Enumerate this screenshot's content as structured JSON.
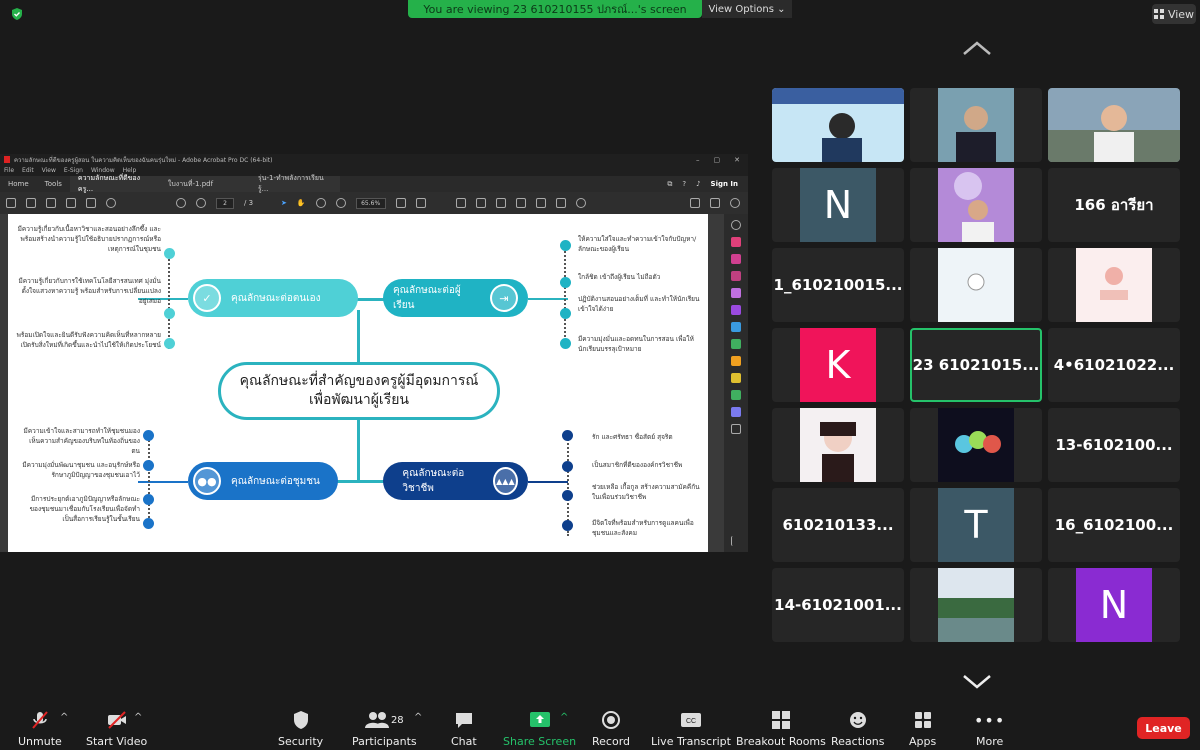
{
  "banner": {
    "text": "You are viewing 23 610210155 ปภรณ์...'s screen",
    "view_options": "View Options"
  },
  "view_button": "View",
  "acrobat": {
    "title": "ความลักษณะที่ดีของครูผู้สอน ในความคิดเห็นของฉันคนรุ่นใหม่ - Adobe Acrobat Pro DC (64-bit)",
    "menu": [
      "File",
      "Edit",
      "View",
      "E-Sign",
      "Window",
      "Help"
    ],
    "tabs": {
      "home": "Home",
      "tools": "Tools",
      "doc1": "ความลักษณะที่ดีของครู...",
      "doc2": "ใบงานที่-1.pdf",
      "doc3": "รุ่น-1-ทำพลังการเรียนรู้..."
    },
    "signin": "Sign In",
    "page_num": "2",
    "page_total": "/ 3",
    "zoom": "65.6%"
  },
  "mindmap": {
    "center_line1": "คุณลักษณะที่สำคัญของครูผู้มีอุดมการณ์",
    "center_line2": "เพื่อพัฒนาผู้เรียน",
    "tl_label": "คุณลักษณะต่อตนเอง",
    "tr_label": "คุณลักษณะต่อผู้เรียน",
    "bl_label": "คุณลักษณะต่อชุมชน",
    "br_label": "คุณลักษณะต่อวิชาชีพ",
    "tl_items": [
      "มีความรู้เกี่ยวกับเนื้อหาวิชาและสอนอย่างลึกซึ้ง และพร้อมสร้างนำความรู้ไปใช้อธิบายปรากฏการณ์หรือเหตุการณ์ในชุมชน",
      "มีความรู้เกี่ยวกับการใช้เทคโนโลยีสารสนเทศ มุ่งมั่นตั้งใจแสวงหาความรู้ พร้อมสำหรับการเปลี่ยนแปลงอยู่เสมอ",
      "พร้อมเปิดใจและยินดีรับฟังความคิดเห็นที่หลากหลาย เปิดรับสิ่งใหม่ที่เกิดขึ้นและนำไปใช้ให้เกิดประโยชน์"
    ],
    "tr_items": [
      "ให้ความใส่ใจและทำความเข้าใจกับปัญหา/ลักษณะของผู้เรียน",
      "ใกล้ชิด เข้าถึงผู้เรียน ไม่ถือตัว",
      "ปฏิบัติงานสอนอย่างเต็มที่ และทำให้นักเรียนเข้าใจได้ง่าย",
      "มีความมุ่งมั่นและอดทนในการสอน เพื่อให้นักเรียนบรรลุเป้าหมาย"
    ],
    "bl_items": [
      "มีความเข้าใจและสามารถทำให้ชุมชนมองเห็นความสำคัญของบริบทในท้องถิ่นของตน",
      "มีความมุ่งมั่นพัฒนาชุมชน และอนุรักษ์หรือรักษาภูมิปัญญาของชุมชนเอาไว้",
      "มีการประยุกต์เอาภูมิปัญญาหรือลักษณะของชุมชนมาเชื่อมกับโรงเรียนเพื่อจัดทำเป็นสื่อการเรียนรู้ในชั้นเรียน"
    ],
    "br_items": [
      "รัก และศรัทธา ซื่อสัตย์ สุจริต",
      "เป็นสมาชิกที่ดีขององค์กรวิชาชีพ",
      "ช่วยเหลือ เกื้อกูล สร้างความสามัคคีกันในเพื่อนร่วมวิชาชีพ",
      "มีจิตใจที่พร้อมสำหรับการดูแลคนเพื่อชุมชนและสังคม"
    ]
  },
  "participants": {
    "n_tile": "N",
    "name_166": "166 อารียา",
    "name_1": "1_610210015...",
    "k_tile": "K",
    "name_23": "23 61021015...",
    "name_4": "4•61021022...",
    "name_13": "13-6102100...",
    "name_610": "610210133...",
    "t_tile": "T",
    "name_16": "16_6102100...",
    "name_14": "14-61021001...",
    "n2_tile": "N"
  },
  "toolbar": {
    "unmute": "Unmute",
    "start_video": "Start Video",
    "security": "Security",
    "participants": "Participants",
    "participants_count": "28",
    "chat": "Chat",
    "share": "Share Screen",
    "record": "Record",
    "transcript": "Live Transcript",
    "breakout": "Breakout Rooms",
    "reactions": "Reactions",
    "apps": "Apps",
    "more": "More",
    "leave": "Leave"
  },
  "colors": {
    "accent_green": "#25b14a",
    "teal": "#2bb3bf",
    "blue": "#1a73c8",
    "navy": "#0e3f8c",
    "leave": "#e02424",
    "k_tile": "#f0145a",
    "n2_tile": "#8a2bd2",
    "slate": "#3c5866"
  }
}
